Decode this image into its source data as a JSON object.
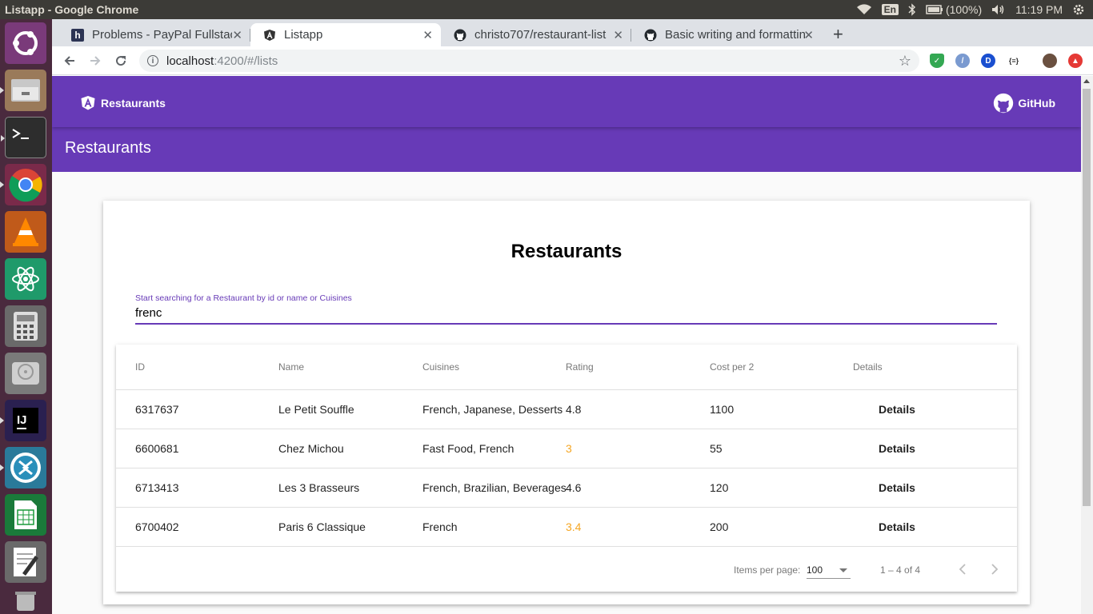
{
  "os": {
    "window_title": "Listapp - Google Chrome",
    "lang": "En",
    "battery": "(100%)",
    "clock": "11:19 PM",
    "launcher_apps": [
      "ubuntu-dash-icon",
      "file-manager-icon",
      "terminal-icon",
      "chrome-icon",
      "vlc-icon",
      "atom-icon",
      "calculator-icon",
      "disk-icon",
      "intellij-icon",
      "remote-desktop-icon",
      "spreadsheet-icon",
      "text-editor-icon",
      "trash-icon"
    ]
  },
  "browser": {
    "tabs": [
      {
        "label": "Problems - PayPal Fullstack",
        "favicon": "h"
      },
      {
        "label": "Listapp",
        "favicon": "angular"
      },
      {
        "label": "christo707/restaurant-list",
        "favicon": "github"
      },
      {
        "label": "Basic writing and formatting",
        "favicon": "github"
      }
    ],
    "url_host": "localhost",
    "url_path": ":4200/#/lists"
  },
  "app": {
    "brand": "Restaurants",
    "github": "GitHub",
    "page_header": "Restaurants",
    "card_title": "Restaurants",
    "search": {
      "label": "Start searching for a Restaurant by id or name or Cuisines",
      "value": "frenc"
    },
    "table": {
      "headers": [
        "ID",
        "Name",
        "Cuisines",
        "Rating",
        "Cost per 2",
        "Details"
      ],
      "rows": [
        {
          "id": "6317637",
          "name": "Le Petit Souffle",
          "cuisines": "French, Japanese, Desserts",
          "rating": "4.8",
          "rating_color": "#000000",
          "cost": "1100",
          "details": "Details"
        },
        {
          "id": "6600681",
          "name": "Chez Michou",
          "cuisines": "Fast Food, French",
          "rating": "3",
          "rating_color": "#f5a623",
          "cost": "55",
          "details": "Details"
        },
        {
          "id": "6713413",
          "name": "Les 3 Brasseurs",
          "cuisines": "French, Brazilian, Beverages",
          "rating": "4.6",
          "rating_color": "#000000",
          "cost": "120",
          "details": "Details"
        },
        {
          "id": "6700402",
          "name": "Paris 6 Classique",
          "cuisines": "French",
          "rating": "3.4",
          "rating_color": "#f5a623",
          "cost": "200",
          "details": "Details"
        }
      ]
    },
    "paginator": {
      "items_per_page_label": "Items per page:",
      "items_per_page": "100",
      "range": "1 – 4 of 4"
    },
    "colors": {
      "primary": "#673ab7",
      "warn_rating": "#f5a623"
    }
  }
}
